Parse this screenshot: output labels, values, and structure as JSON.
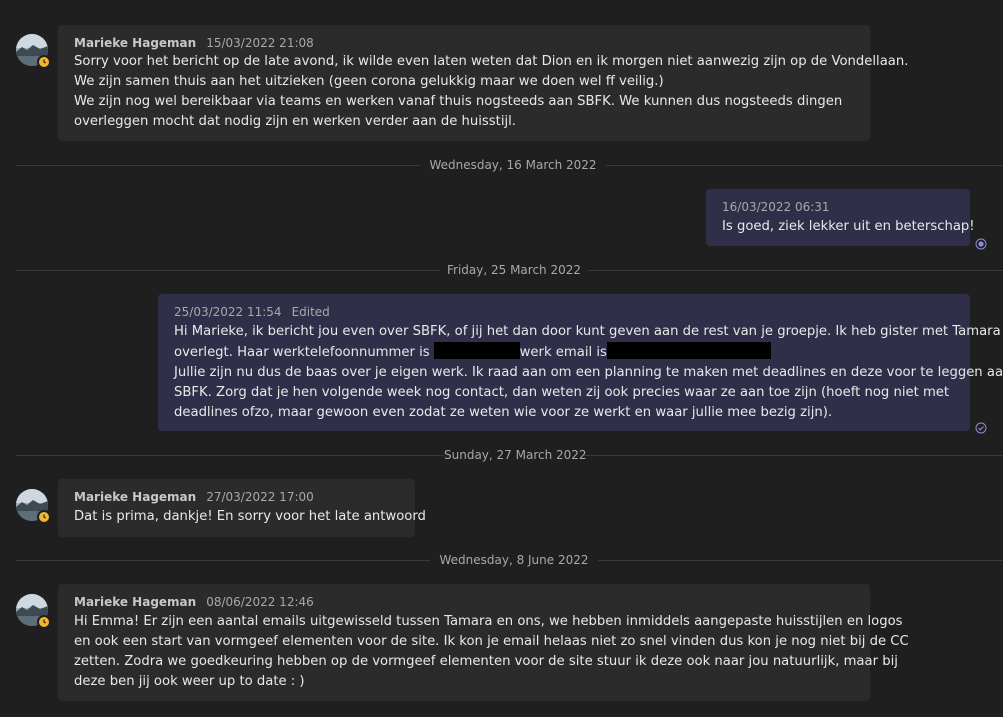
{
  "colors": {
    "background": "#1f1f1f",
    "incoming_bubble": "#2b2b2b",
    "outgoing_bubble": "#2f2f4a",
    "status_away": "#f2b632",
    "read_receipt": "#8c8cd9"
  },
  "messages": [
    {
      "sender": "Marieke Hageman",
      "time": "15/03/2022 21:08",
      "lines": [
        "Sorry voor het bericht op de late avond, ik wilde even laten weten dat Dion en ik morgen niet aanwezig zijn op de Vondellaan.",
        "We zijn samen thuis aan het uitzieken (geen corona gelukkig maar we doen wel ff veilig.)",
        "We zijn nog wel bereikbaar via teams en werken vanaf thuis nogsteeds aan SBFK. We kunnen dus nogsteeds dingen",
        "overleggen mocht dat nodig zijn en werken verder aan de huisstijl."
      ]
    },
    {
      "divider": "Wednesday, 16 March 2022",
      "time": "16/03/2022 06:31",
      "text": "Is goed, ziek lekker uit en beterschap!"
    },
    {
      "divider": "Friday, 25 March 2022",
      "time": "25/03/2022 11:54",
      "edited": "Edited",
      "line1": "Hi Marieke, ik bericht jou even over SBFK, of jij het dan door kunt geven aan de rest van je groepje. Ik heb gister met Tamara",
      "line2_a": "overlegt. Haar werktelefoonnummer is",
      "line2_b": "werk email is",
      "line3": "Jullie zijn nu dus de baas over je eigen werk. Ik raad aan om een planning te maken met deadlines en deze voor te leggen aan",
      "line4": "SBFK. Zorg dat je hen volgende week nog contact, dan weten zij ook precies waar ze aan toe zijn (hoeft nog niet met",
      "line5": "deadlines ofzo, maar gewoon even zodat ze weten wie voor ze werkt en waar jullie mee bezig zijn)."
    },
    {
      "divider": "Sunday, 27 March 2022",
      "sender": "Marieke Hageman",
      "time": "27/03/2022 17:00",
      "text": "Dat is prima, dankje! En sorry voor het late antwoord"
    },
    {
      "divider": "Wednesday, 8 June 2022",
      "sender": "Marieke Hageman",
      "time": "08/06/2022 12:46",
      "lines": [
        "Hi Emma! Er zijn een aantal emails uitgewisseld tussen Tamara en ons, we hebben inmiddels aangepaste huisstijlen en logos",
        "en ook een start van vormgeef elementen voor de site. Ik kon je email helaas niet zo snel vinden dus kon je nog niet bij de CC",
        "zetten. Zodra we goedkeuring hebben op de vormgeef elementen voor de site stuur ik deze ook naar jou natuurlijk, maar bij",
        "deze ben jij ook weer up to date : )"
      ]
    }
  ]
}
